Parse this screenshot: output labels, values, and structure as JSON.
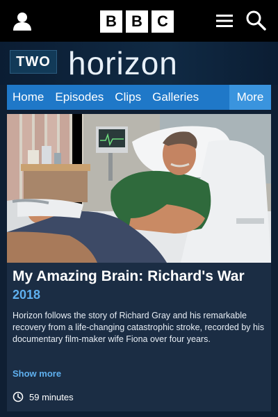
{
  "topbar": {
    "account_icon": "person-icon",
    "logo_letters": [
      "B",
      "B",
      "C"
    ],
    "menu_icon": "hamburger-menu-icon",
    "search_icon": "search-icon"
  },
  "brand": {
    "channel": "TWO",
    "title": "horizon"
  },
  "nav": {
    "items": [
      "Home",
      "Episodes",
      "Clips",
      "Galleries"
    ],
    "more": "More",
    "color": "#1f78c8"
  },
  "episode": {
    "image_icon": "hospital-patient-photo",
    "title": "My Amazing Brain: Richard's War",
    "year": "2018",
    "description": "Horizon follows the story of Richard Gray and his remarkable recovery from a life-changing catastrophic stroke, recorded by his documentary film-maker wife Fiona over four years.",
    "show_more": "Show more",
    "duration": "59 minutes",
    "duration_icon": "clock-icon",
    "accent_color": "#5fb0ef"
  }
}
